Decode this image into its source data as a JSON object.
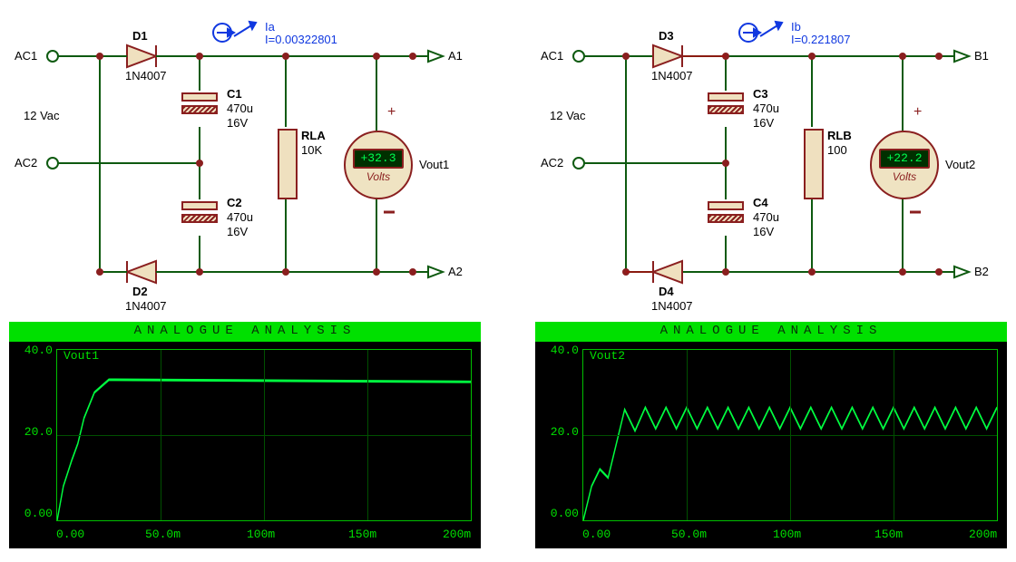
{
  "circuits": [
    {
      "side": "left",
      "ports": {
        "acTop": "AC1",
        "acBot": "AC2",
        "outTop": "A1",
        "outBot": "A2"
      },
      "vSource": "12 Vac",
      "dTop": {
        "ref": "D1",
        "part": "1N4007"
      },
      "dBot": {
        "ref": "D2",
        "part": "1N4007"
      },
      "cTop": {
        "ref": "C1",
        "val": "470u",
        "rating": "16V"
      },
      "cBot": {
        "ref": "C2",
        "val": "470u",
        "rating": "16V"
      },
      "rLoad": {
        "ref": "RLA",
        "val": "10K"
      },
      "probe": {
        "name": "Ia",
        "reading": "I=0.00322801"
      },
      "meter": {
        "value": "+32.3",
        "unit": "Volts",
        "out": "Vout1"
      }
    },
    {
      "side": "right",
      "ports": {
        "acTop": "AC1",
        "acBot": "AC2",
        "outTop": "B1",
        "outBot": "B2"
      },
      "vSource": "12 Vac",
      "dTop": {
        "ref": "D3",
        "part": "1N4007"
      },
      "dBot": {
        "ref": "D4",
        "part": "1N4007"
      },
      "cTop": {
        "ref": "C3",
        "val": "470u",
        "rating": "16V"
      },
      "cBot": {
        "ref": "C4",
        "val": "470u",
        "rating": "16V"
      },
      "rLoad": {
        "ref": "RLB",
        "val": "100"
      },
      "probe": {
        "name": "Ib",
        "reading": "I=0.221807"
      },
      "meter": {
        "value": "+22.2",
        "unit": "Volts",
        "out": "Vout2"
      }
    }
  ],
  "graphs": [
    {
      "title": "ANALOGUE  ANALYSIS",
      "trace_label": "Vout1",
      "yTicks": [
        "40.0",
        "20.0",
        "0.00"
      ],
      "xTicks": [
        "0.00",
        "50.0m",
        "100m",
        "150m",
        "200m"
      ],
      "chart_data": {
        "type": "line",
        "ylim": [
          0,
          40
        ],
        "xlim": [
          0,
          0.2
        ],
        "x": [
          0.0,
          0.003,
          0.007,
          0.01,
          0.013,
          0.018,
          0.025,
          0.2
        ],
        "y": [
          0.0,
          8.0,
          14.0,
          18.0,
          24.0,
          30.0,
          33.0,
          32.5
        ]
      }
    },
    {
      "title": "ANALOGUE  ANALYSIS",
      "trace_label": "Vout2",
      "yTicks": [
        "40.0",
        "20.0",
        "0.00"
      ],
      "xTicks": [
        "0.00",
        "50.0m",
        "100m",
        "150m",
        "200m"
      ],
      "chart_data": {
        "type": "line",
        "ylim": [
          0,
          40
        ],
        "xlim": [
          0,
          0.2
        ],
        "x": [
          0.0,
          0.004,
          0.008,
          0.012,
          0.016,
          0.02,
          0.025,
          0.03,
          0.035,
          0.04,
          0.045,
          0.05,
          0.055,
          0.06,
          0.065,
          0.07,
          0.075,
          0.08,
          0.085,
          0.09,
          0.095,
          0.1,
          0.105,
          0.11,
          0.115,
          0.12,
          0.125,
          0.13,
          0.135,
          0.14,
          0.145,
          0.15,
          0.155,
          0.16,
          0.165,
          0.17,
          0.175,
          0.18,
          0.185,
          0.19,
          0.195,
          0.2
        ],
        "y": [
          0.0,
          8.0,
          12.0,
          10.0,
          18.0,
          26.0,
          21.0,
          26.5,
          21.5,
          26.5,
          21.5,
          26.5,
          21.5,
          26.5,
          21.5,
          26.5,
          21.5,
          26.5,
          21.5,
          26.5,
          21.5,
          26.5,
          21.5,
          26.5,
          21.5,
          26.5,
          21.5,
          26.5,
          21.5,
          26.5,
          21.5,
          26.5,
          21.5,
          26.5,
          21.5,
          26.5,
          21.5,
          26.5,
          21.5,
          26.5,
          21.5,
          26.5
        ]
      }
    }
  ]
}
